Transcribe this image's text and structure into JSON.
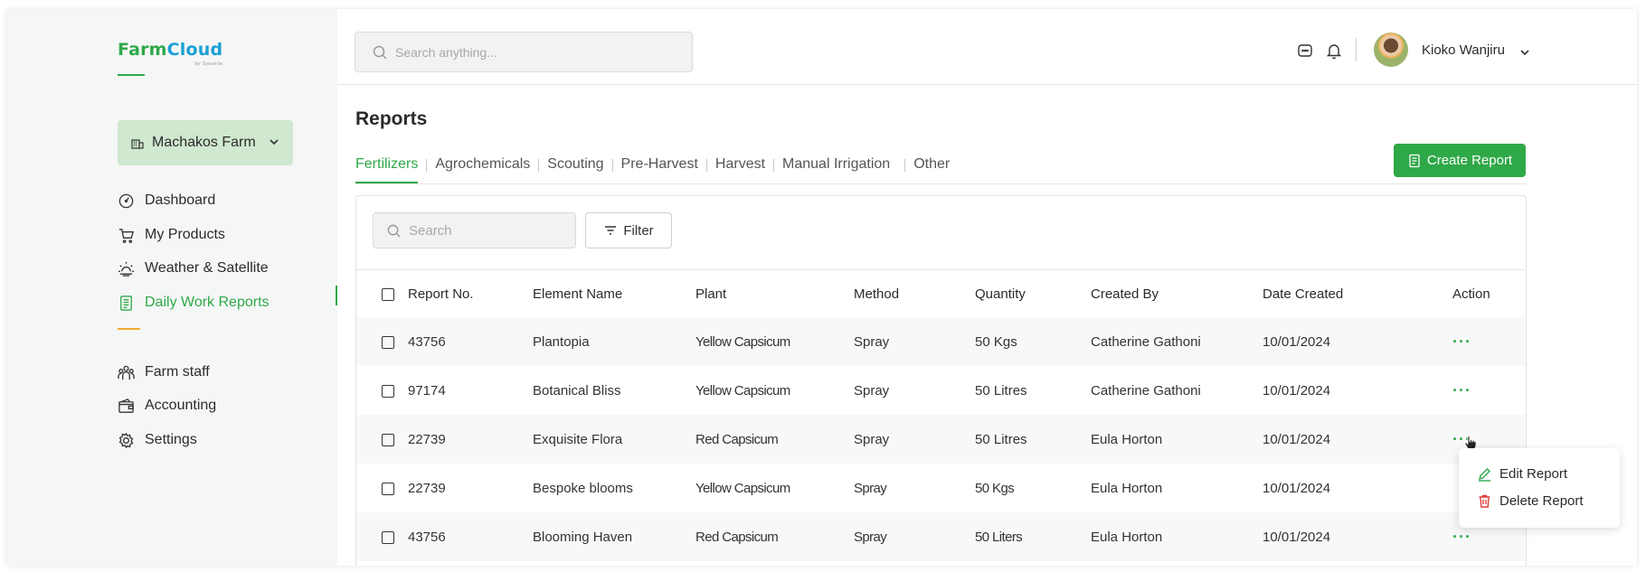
{
  "brand": {
    "logo_part1": "FarmCloud",
    "logo_sub": "by Syovelle",
    "colors": {
      "primary": "#2fa848",
      "cloud_blue": "#1a9fd6",
      "accent_orange": "#f0a830",
      "farm_select_bg": "#cfe8cf"
    }
  },
  "sidebar": {
    "farm_selector": "Machakos Farm",
    "items": [
      {
        "label": "Dashboard",
        "icon": "dashboard-icon"
      },
      {
        "label": "My Products",
        "icon": "cart-icon"
      },
      {
        "label": "Weather & Satellite",
        "icon": "weather-icon"
      },
      {
        "label": "Daily Work Reports",
        "icon": "report-icon",
        "active": true
      }
    ],
    "items_secondary": [
      {
        "label": "Farm staff",
        "icon": "people-icon"
      },
      {
        "label": "Accounting",
        "icon": "wallet-icon"
      },
      {
        "label": "Settings",
        "icon": "gear-icon"
      }
    ]
  },
  "topbar": {
    "search_placeholder": "Search anything...",
    "user_name": "Kioko Wanjiru"
  },
  "main": {
    "title": "Reports",
    "tabs": [
      "Fertilizers",
      "Agrochemicals",
      "Scouting",
      "Pre-Harvest",
      "Harvest",
      "Manual Irrigation",
      "Other"
    ],
    "active_tab": "Fertilizers",
    "create_button": "Create Report",
    "search_placeholder": "Search",
    "filter_label": "Filter",
    "columns": [
      "Report No.",
      "Element Name",
      "Plant",
      "Method",
      "Quantity",
      "Created By",
      "Date Created",
      "Action"
    ],
    "rows": [
      {
        "report_no": "43756",
        "element": "Plantopia",
        "plant": "Yellow Capsicum",
        "method": "Spray",
        "quantity": "50 Kgs",
        "created_by": "Catherine Gathoni",
        "date": "10/01/2024",
        "action": "···"
      },
      {
        "report_no": "97174",
        "element": "Botanical Bliss",
        "plant": "Yellow Capsicum",
        "method": "Spray",
        "quantity": "50 Litres",
        "created_by": "Catherine Gathoni",
        "date": "10/01/2024",
        "action": "···"
      },
      {
        "report_no": "22739",
        "element": "Exquisite Flora",
        "plant": "Red Capsicum",
        "method": "Spray",
        "quantity": "50 Litres",
        "created_by": "Eula Horton",
        "date": "10/01/2024",
        "action": "···"
      },
      {
        "report_no": "22739",
        "element": "Bespoke blooms",
        "plant": "Yellow Capsicum",
        "method": "Spray",
        "quantity": "50 Kgs",
        "created_by": "Eula Horton",
        "date": "10/01/2024",
        "action": ""
      },
      {
        "report_no": "43756",
        "element": "Blooming Haven",
        "plant": "Red Capsicum",
        "method": "Spray",
        "quantity": "50 Liters",
        "created_by": "Eula Horton",
        "date": "10/01/2024",
        "action": "···"
      }
    ],
    "context_menu": {
      "edit": "Edit Report",
      "delete": "Delete Report"
    }
  }
}
